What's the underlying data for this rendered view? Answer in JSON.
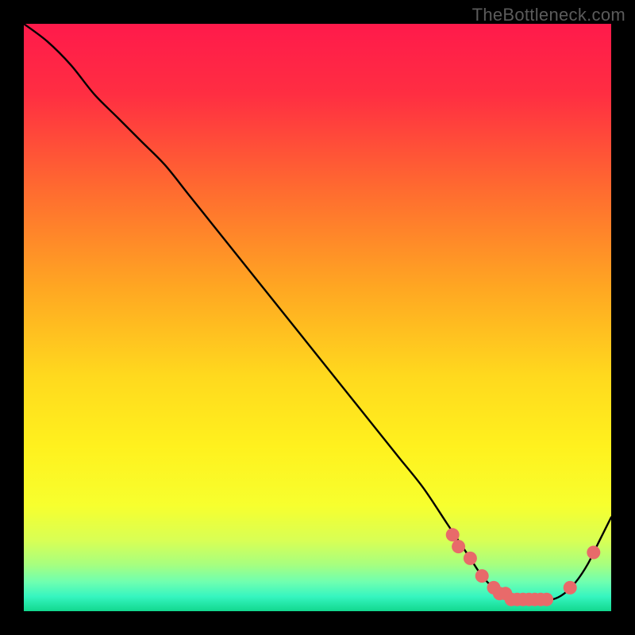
{
  "watermark": "TheBottleneck.com",
  "chart_data": {
    "type": "line",
    "title": "",
    "xlabel": "",
    "ylabel": "",
    "xlim": [
      0,
      100
    ],
    "ylim": [
      0,
      100
    ],
    "series": [
      {
        "name": "bottleneck-curve",
        "x": [
          0,
          4,
          8,
          12,
          16,
          20,
          24,
          28,
          32,
          36,
          40,
          44,
          48,
          52,
          56,
          60,
          64,
          68,
          72,
          74,
          76,
          78,
          80,
          82,
          84,
          86,
          88,
          90,
          92,
          94,
          96,
          98,
          100
        ],
        "y": [
          100,
          97,
          93,
          88,
          84,
          80,
          76,
          71,
          66,
          61,
          56,
          51,
          46,
          41,
          36,
          31,
          26,
          21,
          15,
          12,
          9,
          6,
          4,
          3,
          2,
          2,
          2,
          2,
          3,
          5,
          8,
          12,
          16
        ],
        "color": "#000000"
      }
    ],
    "markers": {
      "name": "dots",
      "color": "#e86a6a",
      "points": [
        {
          "x": 73,
          "y": 13
        },
        {
          "x": 74,
          "y": 11
        },
        {
          "x": 76,
          "y": 9
        },
        {
          "x": 78,
          "y": 6
        },
        {
          "x": 80,
          "y": 4
        },
        {
          "x": 81,
          "y": 3
        },
        {
          "x": 82,
          "y": 3
        },
        {
          "x": 83,
          "y": 2
        },
        {
          "x": 84,
          "y": 2
        },
        {
          "x": 85,
          "y": 2
        },
        {
          "x": 86,
          "y": 2
        },
        {
          "x": 87,
          "y": 2
        },
        {
          "x": 88,
          "y": 2
        },
        {
          "x": 89,
          "y": 2
        },
        {
          "x": 93,
          "y": 4
        },
        {
          "x": 97,
          "y": 10
        }
      ]
    },
    "gradient": {
      "stops": [
        {
          "offset": 0.0,
          "color": "#ff1a4b"
        },
        {
          "offset": 0.12,
          "color": "#ff2e42"
        },
        {
          "offset": 0.28,
          "color": "#ff6a30"
        },
        {
          "offset": 0.45,
          "color": "#ffa722"
        },
        {
          "offset": 0.6,
          "color": "#ffd91e"
        },
        {
          "offset": 0.72,
          "color": "#fff11e"
        },
        {
          "offset": 0.82,
          "color": "#f7ff2e"
        },
        {
          "offset": 0.88,
          "color": "#d8ff55"
        },
        {
          "offset": 0.92,
          "color": "#a8ff7e"
        },
        {
          "offset": 0.95,
          "color": "#6fffb0"
        },
        {
          "offset": 0.975,
          "color": "#36f5c0"
        },
        {
          "offset": 1.0,
          "color": "#12d88e"
        }
      ]
    }
  }
}
